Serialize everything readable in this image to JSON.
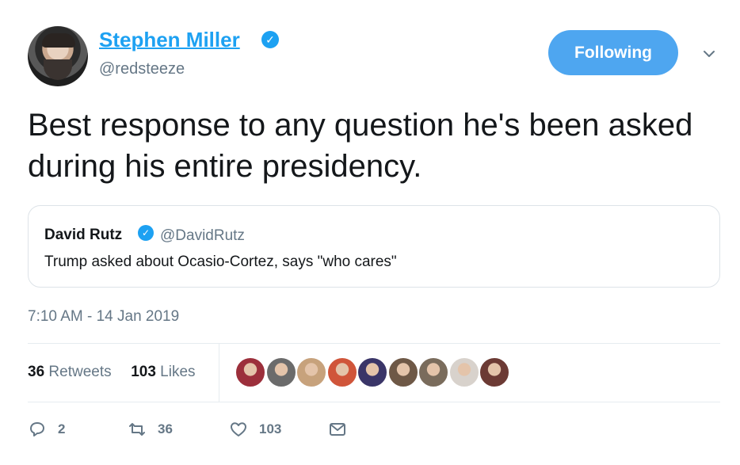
{
  "author": {
    "display_name": "Stephen Miller",
    "handle": "@redsteeze",
    "verified_icon": "verified-badge-icon"
  },
  "follow_button": {
    "label": "Following"
  },
  "menu_caret_icon": "chevron-down-icon",
  "tweet": {
    "text": "Best response to any question he's been asked during his entire presidency."
  },
  "quoted_tweet": {
    "display_name": "David Rutz",
    "handle": "@DavidRutz",
    "text": "Trump asked about Ocasio-Cortez, says \"who cares\""
  },
  "timestamp": "7:10 AM - 14 Jan 2019",
  "stats": {
    "retweets_count": "36",
    "retweets_label": "Retweets",
    "likes_count": "103",
    "likes_label": "Likes"
  },
  "liker_avatar_colors": [
    "#9c2f3b",
    "#6b6b6b",
    "#c7a27c",
    "#d0553a",
    "#3a3568",
    "#6e5846",
    "#7a6c5c",
    "#d8d2cc",
    "#6c3a34"
  ],
  "actions": {
    "reply_count": "2",
    "retweet_count": "36",
    "like_count": "103"
  },
  "colors": {
    "accent": "#1da1f2",
    "follow_button": "#4ea6f0",
    "muted_text": "#657786"
  }
}
